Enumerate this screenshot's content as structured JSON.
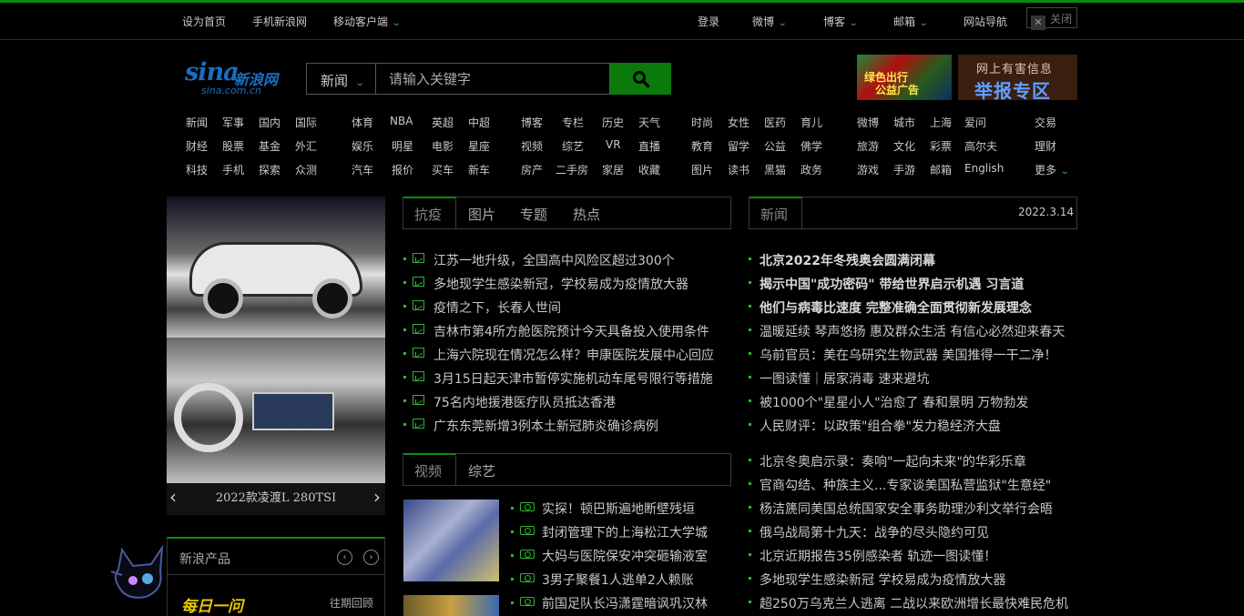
{
  "topbar": {
    "left": [
      "设为首页",
      "手机新浪网",
      "移动客户端"
    ],
    "right": [
      "登录",
      "微博",
      "博客",
      "邮箱",
      "网站导航"
    ],
    "close": "关闭"
  },
  "logo": {
    "main": "sina",
    "cn": "新浪网",
    "url": "sina.com.cn"
  },
  "search": {
    "category": "新闻",
    "placeholder": "请输入关键字"
  },
  "ads": {
    "ad1": [
      "绿色出行",
      "公益广告"
    ],
    "ad2_line1": "网上有害信息",
    "ad2_line2": "举报专区"
  },
  "nav": {
    "g1": [
      [
        "新闻",
        "军事",
        "国内",
        "国际"
      ],
      [
        "财经",
        "股票",
        "基金",
        "外汇"
      ],
      [
        "科技",
        "手机",
        "探索",
        "众测"
      ]
    ],
    "g2": [
      [
        "体育",
        "NBA",
        "英超",
        "中超"
      ],
      [
        "娱乐",
        "明星",
        "电影",
        "星座"
      ],
      [
        "汽车",
        "报价",
        "买车",
        "新车"
      ]
    ],
    "g3": [
      [
        "博客",
        "专栏",
        "历史",
        "天气"
      ],
      [
        "视频",
        "综艺",
        "VR",
        "直播"
      ],
      [
        "房产",
        "二手房",
        "家居",
        "收藏"
      ]
    ],
    "g4": [
      [
        "时尚",
        "女性",
        "医药",
        "育儿"
      ],
      [
        "教育",
        "留学",
        "公益",
        "佛学"
      ],
      [
        "图片",
        "读书",
        "黑猫",
        "政务"
      ]
    ],
    "g5": [
      [
        "微博",
        "城市",
        "上海",
        "爱问"
      ],
      [
        "旅游",
        "文化",
        "彩票",
        "高尔夫"
      ],
      [
        "游戏",
        "手游",
        "邮箱",
        "English"
      ]
    ],
    "g6": [
      "交易",
      "理财",
      "更多"
    ]
  },
  "slider": {
    "caption": "2022款凌渡L 280TSI"
  },
  "products": {
    "title": "新浪产品",
    "daily": "每日一问",
    "past": "往期回顾"
  },
  "mid_tabs": [
    "抗疫",
    "图片",
    "专题",
    "热点"
  ],
  "mid_news": [
    "江苏一地升级，全国高中风险区超过300个",
    "多地现学生感染新冠，学校易成为疫情放大器",
    "疫情之下，长春人世间",
    "吉林市第4所方舱医院预计今天具备投入使用条件",
    "上海六院现在情况怎么样？申康医院发展中心回应",
    "3月15日起天津市暂停实施机动车尾号限行等措施",
    "75名内地援港医疗队员抵达香港",
    "广东东莞新增3例本土新冠肺炎确诊病例"
  ],
  "video_tabs": [
    "视频",
    "综艺"
  ],
  "video_news": [
    "实探！顿巴斯遍地断壁残垣",
    "封闭管理下的上海松江大学城",
    "大妈与医院保安冲突砸输液室",
    "3男子聚餐1人逃单2人赖账",
    "前国足队长冯潇霆暗讽巩汉林"
  ],
  "right_tab": "新闻",
  "date": "2022.3.14",
  "right_news_top": [
    "北京2022年冬残奥会圆满闭幕",
    "揭示中国\"成功密码\" 带给世界启示机遇 习言道",
    "他们与病毒比速度 完整准确全面贯彻新发展理念"
  ],
  "right_news_mid": [
    "温暖延续 琴声悠扬 惠及群众生活 有信心必然迎来春天",
    "乌前官员：美在乌研究生物武器 美国推得一干二净！",
    "一图读懂｜居家消毒 速来避坑",
    "被1000个\"星星小人\"治愈了 春和景明 万物勃发",
    "人民财评：以政策\"组合拳\"发力稳经济大盘"
  ],
  "right_news_bottom": [
    "北京冬奥启示录：奏响\"一起向未来\"的华彩乐章",
    "官商勾结、种族主义...专家谈美国私营监狱\"生意经\"",
    "杨洁篪同美国总统国家安全事务助理沙利文举行会晤",
    "俄乌战局第十九天：战争的尽头隐约可见",
    "北京近期报告35例感染者 轨迹一图读懂！",
    "多地现学生感染新冠 学校易成为疫情放大器",
    "超250万乌克兰人逃离 二战以来欧洲增长最快难民危机"
  ],
  "colors": {
    "accent": "#0f8a0f",
    "green_text": "#2fb52f",
    "background": "#000000"
  }
}
